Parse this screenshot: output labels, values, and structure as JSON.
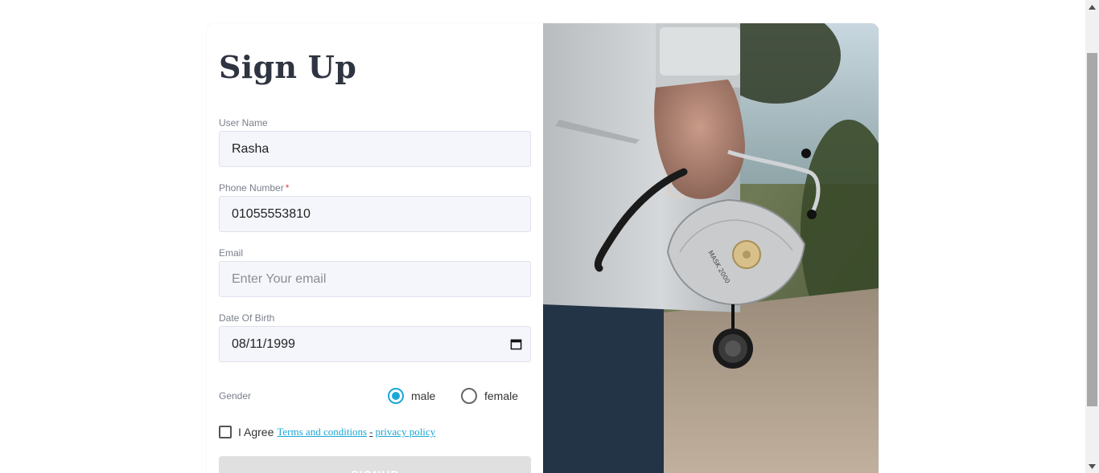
{
  "form": {
    "title": "Sign Up",
    "username": {
      "label": "User Name",
      "value": "Rasha"
    },
    "phone": {
      "label": "Phone Number",
      "required_mark": "*",
      "value": "01055553810"
    },
    "email": {
      "label": "Email",
      "placeholder": "Enter Your email",
      "value": ""
    },
    "dob": {
      "label": "Date Of Birth",
      "value": "08/11/1999"
    },
    "gender": {
      "label": "Gender",
      "options": [
        {
          "label": "male",
          "checked": true
        },
        {
          "label": "female",
          "checked": false
        }
      ]
    },
    "agree": {
      "prefix": "I Agree",
      "terms_link": "Terms and conditions",
      "separator": "-",
      "privacy_link": "privacy policy",
      "checked": false
    },
    "submit_label": "SIGNUP"
  },
  "image": {
    "icon": "doctor-stethoscope-mask-photo"
  },
  "colors": {
    "accent": "#1aa7d6",
    "input_bg": "#f5f6fc",
    "title": "#2e3440",
    "required": "#e53935"
  }
}
